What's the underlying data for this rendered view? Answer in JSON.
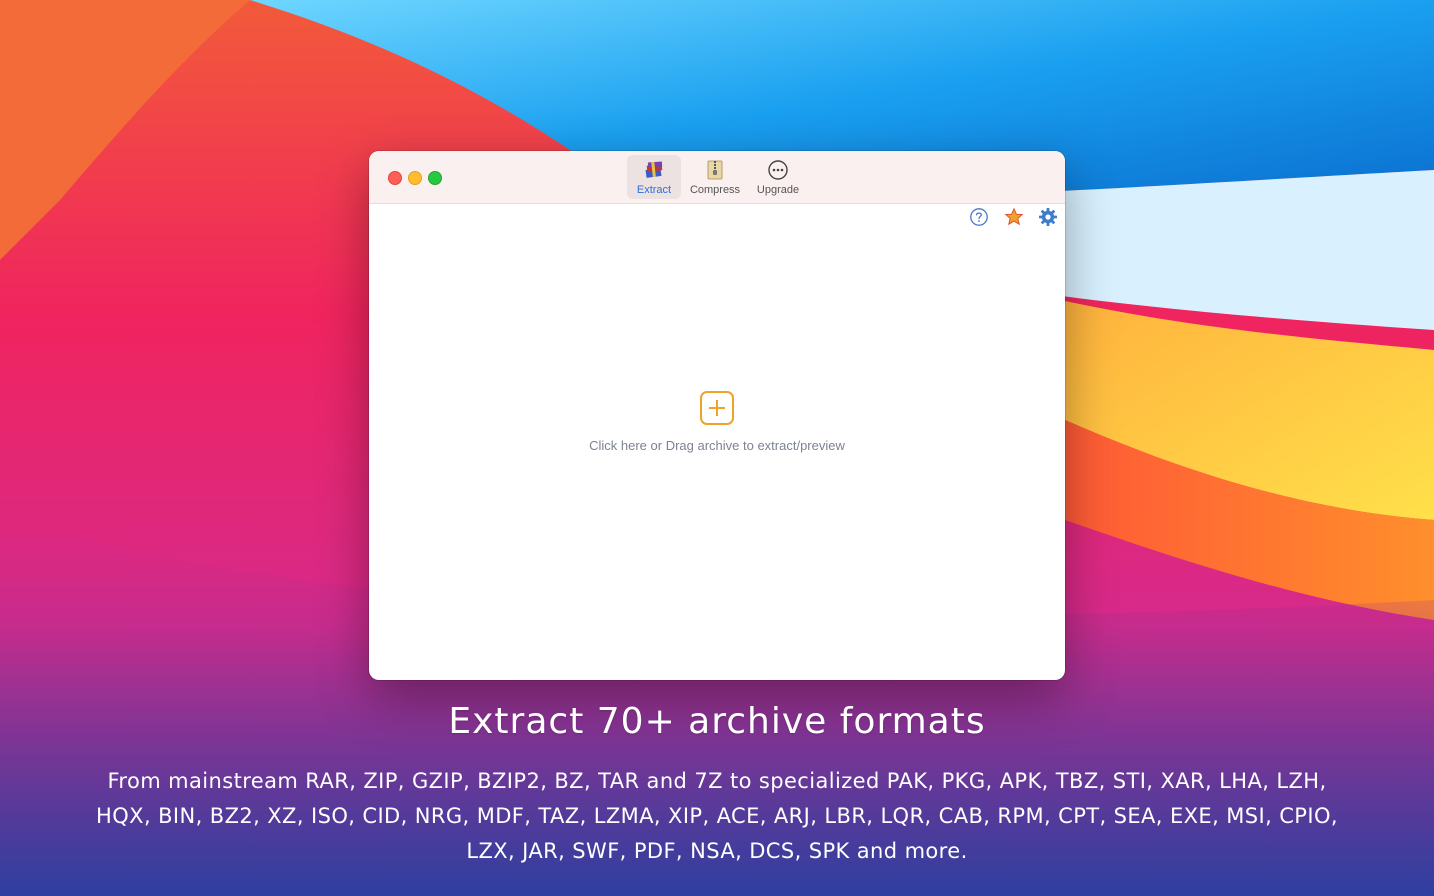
{
  "toolbar": {
    "items": [
      {
        "label": "Extract",
        "icon": "archive-books-icon",
        "active": true
      },
      {
        "label": "Compress",
        "icon": "zip-file-icon",
        "active": false
      },
      {
        "label": "Upgrade",
        "icon": "more-circle-icon",
        "active": false
      }
    ]
  },
  "corner_icons": [
    "help-icon",
    "star-icon",
    "gear-icon"
  ],
  "drop_zone": {
    "icon": "add-square-icon",
    "hint": "Click here or Drag archive to extract/preview"
  },
  "marketing": {
    "headline": "Extract 70+ archive formats",
    "description": "From mainstream RAR, ZIP, GZIP, BZIP2, BZ, TAR and 7Z to specialized PAK, PKG, APK, TBZ, STI, XAR, LHA, LZH, HQX, BIN, BZ2, XZ, ISO, CID, NRG, MDF, TAZ, LZMA, XIP, ACE, ARJ, LBR, LQR, CAB, RPM, CPT, SEA, EXE, MSI, CPIO, LZX, JAR, SWF, PDF, NSA, DCS, SPK and more."
  },
  "colors": {
    "accent_orange": "#f1a22a",
    "active_tab_text": "#2f6fd6",
    "hint_text": "#7d8394"
  }
}
